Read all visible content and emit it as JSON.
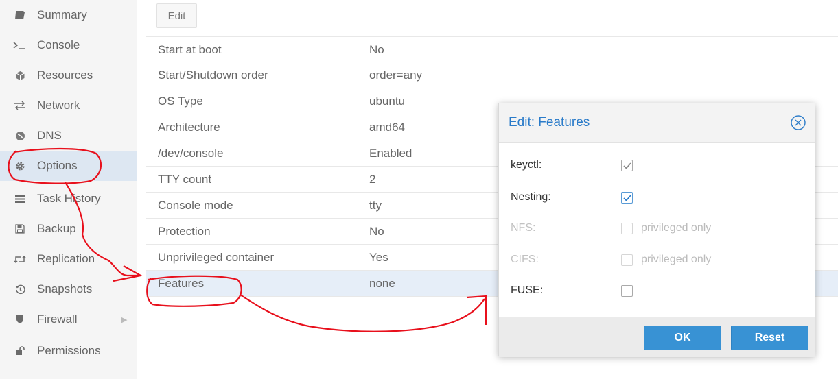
{
  "sidebar": {
    "items": [
      {
        "label": "Summary",
        "icon": "book-icon"
      },
      {
        "label": "Console",
        "icon": "terminal-icon"
      },
      {
        "label": "Resources",
        "icon": "cube-icon"
      },
      {
        "label": "Network",
        "icon": "exchange-icon"
      },
      {
        "label": "DNS",
        "icon": "globe-icon"
      },
      {
        "label": "Options",
        "icon": "gear-icon"
      },
      {
        "label": "Task History",
        "icon": "list-icon"
      },
      {
        "label": "Backup",
        "icon": "floppy-icon"
      },
      {
        "label": "Replication",
        "icon": "retweet-icon"
      },
      {
        "label": "Snapshots",
        "icon": "history-icon"
      },
      {
        "label": "Firewall",
        "icon": "shield-icon"
      },
      {
        "label": "Permissions",
        "icon": "unlock-icon"
      }
    ],
    "active": "Options"
  },
  "toolbar": {
    "edit_label": "Edit"
  },
  "options": {
    "rows": [
      {
        "name": "Start at boot",
        "value": "No"
      },
      {
        "name": "Start/Shutdown order",
        "value": "order=any"
      },
      {
        "name": "OS Type",
        "value": "ubuntu"
      },
      {
        "name": "Architecture",
        "value": "amd64"
      },
      {
        "name": "/dev/console",
        "value": "Enabled"
      },
      {
        "name": "TTY count",
        "value": "2"
      },
      {
        "name": "Console mode",
        "value": "tty"
      },
      {
        "name": "Protection",
        "value": "No"
      },
      {
        "name": "Unprivileged container",
        "value": "Yes"
      },
      {
        "name": "Features",
        "value": "none"
      }
    ],
    "selected": "Features"
  },
  "dialog": {
    "title": "Edit: Features",
    "fields": [
      {
        "label": "keyctl:",
        "checked": true,
        "disabled": false,
        "extra": ""
      },
      {
        "label": "Nesting:",
        "checked": true,
        "disabled": false,
        "extra": ""
      },
      {
        "label": "NFS:",
        "checked": false,
        "disabled": true,
        "extra": "privileged only"
      },
      {
        "label": "CIFS:",
        "checked": false,
        "disabled": true,
        "extra": "privileged only"
      },
      {
        "label": "FUSE:",
        "checked": false,
        "disabled": false,
        "extra": ""
      }
    ],
    "ok_label": "OK",
    "reset_label": "Reset"
  },
  "colors": {
    "accent": "#3892d4",
    "title": "#2a7bc9",
    "annotation": "#e8101c",
    "check_blue": "#2a7bc9",
    "check_gray": "#888888"
  }
}
